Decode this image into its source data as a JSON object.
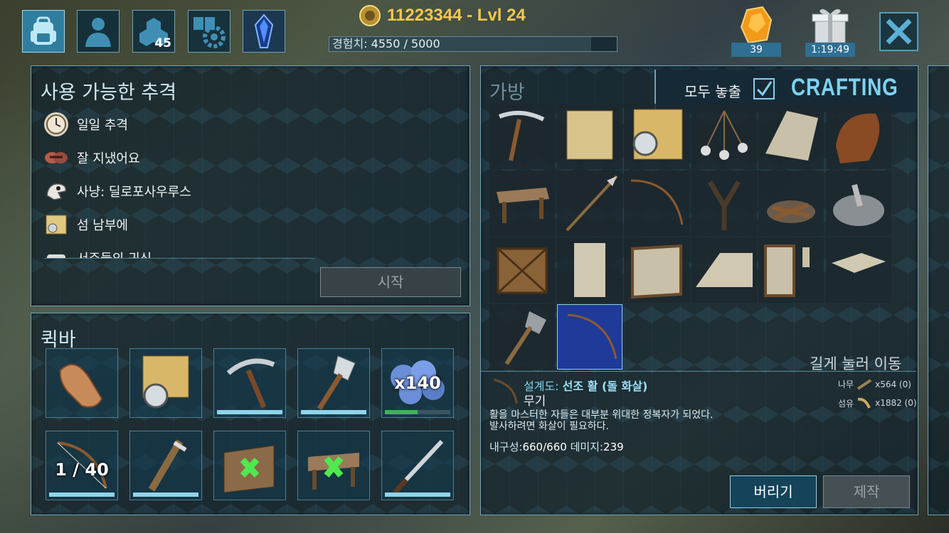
{
  "topbar": {
    "buttons": [
      {
        "name": "inventory-button",
        "icon": "backpack-icon"
      },
      {
        "name": "character-button",
        "icon": "person-icon"
      },
      {
        "name": "engrams-button",
        "icon": "hexagons-icon",
        "count": "45"
      },
      {
        "name": "settings-button",
        "icon": "gear-icon"
      },
      {
        "name": "obelisk-button",
        "icon": "crystal-icon"
      }
    ],
    "player_title": "11223344 - Lvl 24",
    "xp_label": "경험치",
    "xp_value": ": 4550 / 5000",
    "xp_progress": 0.91,
    "amber_count": "39",
    "gift_timer": "1:19:49"
  },
  "quests": {
    "title": "사용 가능한 추격",
    "items": [
      {
        "label": "일일 추격",
        "icon": "clock-icon"
      },
      {
        "label": "잘 지냈어요",
        "icon": "handshake-icon"
      },
      {
        "label": "사냥: 딜로포사우루스",
        "icon": "dino-skull-icon"
      },
      {
        "label": "섬 남부에",
        "icon": "map-icon"
      },
      {
        "label": "서주들의 귀신",
        "icon": "bone-icon"
      }
    ],
    "start_label": "시작"
  },
  "quickbar": {
    "title": "퀵바",
    "slots": [
      {
        "icon": "hand-icon",
        "overlay": "",
        "durability": null
      },
      {
        "icon": "map-compass-icon",
        "overlay": "",
        "durability": null
      },
      {
        "icon": "pickaxe-icon",
        "overlay": "",
        "durability": 1.0
      },
      {
        "icon": "hatchet-icon",
        "overlay": "",
        "durability": 1.0
      },
      {
        "icon": "berries-icon",
        "overlay": "x140",
        "durability": 0.5
      },
      {
        "icon": "bow-icon",
        "overlay": "1 / 40",
        "durability": 1.0
      },
      {
        "icon": "torch-icon",
        "overlay": "",
        "durability": 1.0
      },
      {
        "icon": "wall-structure-icon",
        "overlay": "",
        "durability": null
      },
      {
        "icon": "table-structure-icon",
        "overlay": "",
        "durability": null
      },
      {
        "icon": "sword-icon",
        "overlay": "",
        "durability": 1.0
      }
    ]
  },
  "inventory": {
    "title": "가방",
    "show_all_label": "모두 놓출",
    "show_all_checked": true,
    "crafting_label": "CRAFTING",
    "hint": "길게 눌러 이동",
    "items": [
      "pickaxe-icon",
      "map-icon",
      "compass-map-icon",
      "bola-icon",
      "thatch-icon",
      "sleeping-bag-icon",
      "table-icon",
      "spear-icon",
      "bow-icon",
      "slingshot-icon",
      "campfire-icon",
      "mortar-pestle-icon",
      "wooden-crate-icon",
      "thatch-wall-icon",
      "thatch-door-frame-icon",
      "thatch-roof-icon",
      "thatch-doorframe-icon",
      "thatch-ceiling-icon",
      "hatchet-icon",
      "bow-blueprint-icon"
    ],
    "selected_index": 19
  },
  "detail": {
    "name_prefix": "설계도: ",
    "name": "선조 활 (돌 화살)",
    "type": "무기",
    "description_line1": "활을 마스터한 자들은 대부분 위대한 정복자가 되었다.",
    "description_line2": "발사하려면 화살이 필요하다.",
    "durability_label": "내구성:",
    "durability_value": "660/660",
    "damage_label": "데미지:",
    "damage_value": "239",
    "materials": [
      {
        "name": "나무",
        "icon": "wood-icon",
        "qty": "x564 (0)"
      },
      {
        "name": "섬유",
        "icon": "fiber-icon",
        "qty": "x1882 (0)"
      }
    ],
    "drop_label": "버리기",
    "craft_label": "제작"
  },
  "colors": {
    "accent": "#7fd2f0",
    "gold": "#f2c94c",
    "panel_border": "#6fa3b8",
    "selected": "#1f3a98"
  }
}
